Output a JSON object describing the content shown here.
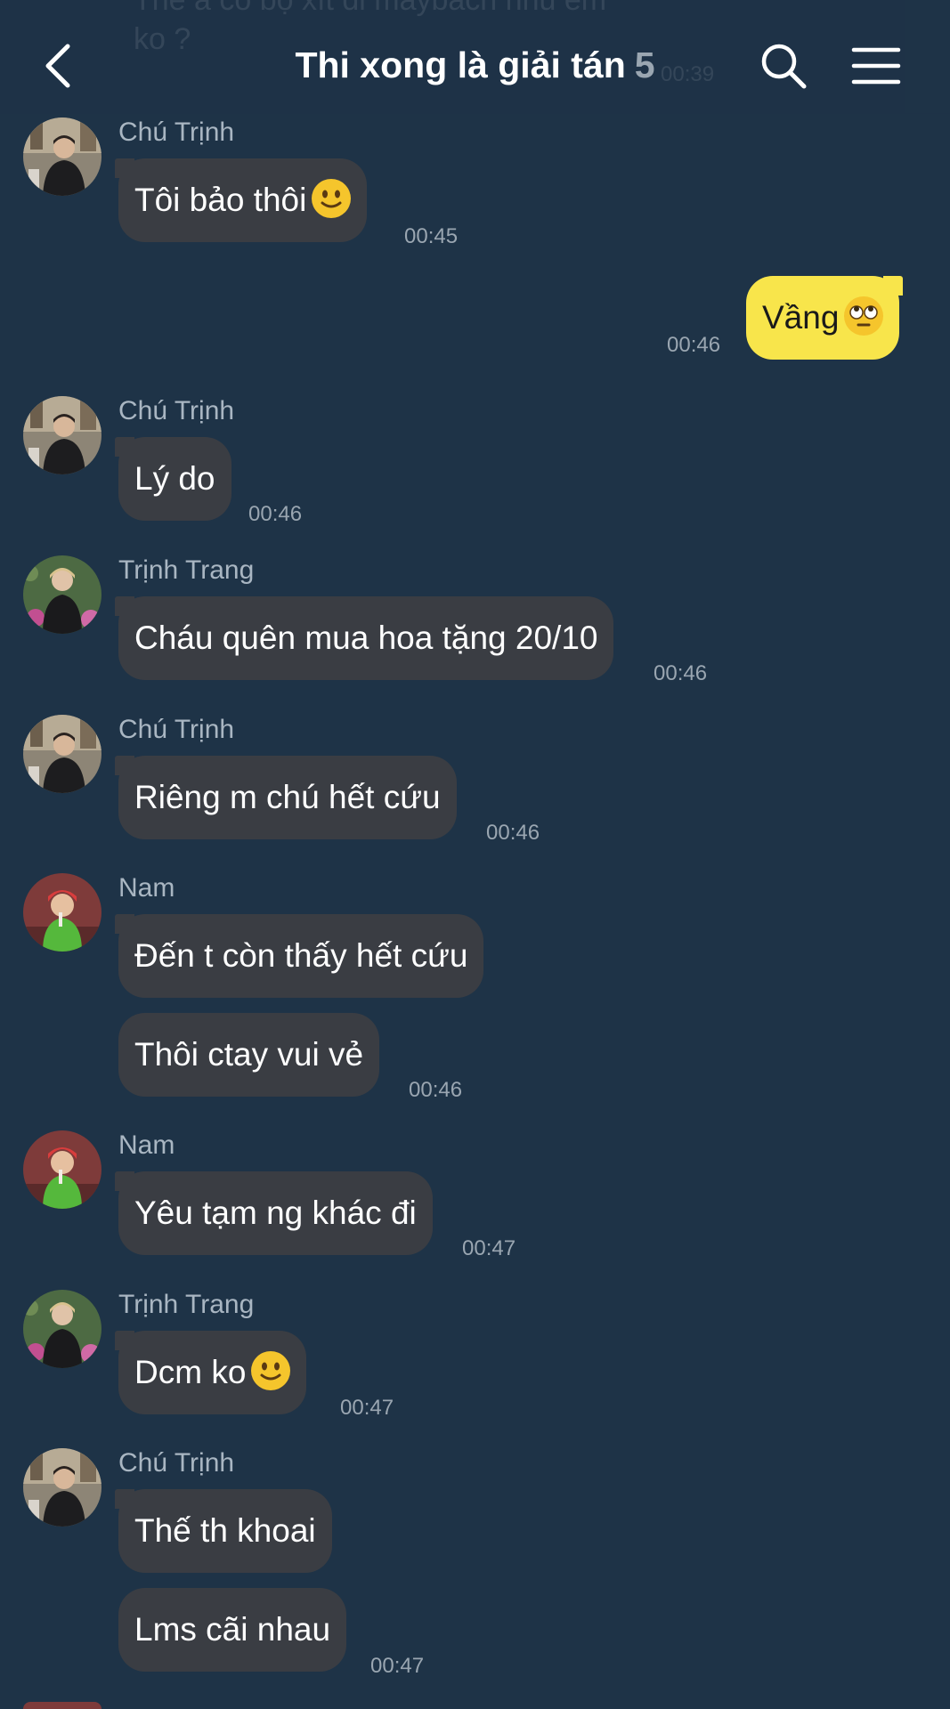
{
  "header": {
    "title": "Thi xong là giải tán",
    "member_count": "5",
    "prev_text": "Thế a có bộ xít đi maybach nhu em ko ?",
    "prev_time": "00:39"
  },
  "icons": {
    "back": "chevron-left-icon",
    "search": "search-icon",
    "menu": "hamburger-menu-icon",
    "slight_smile": "slightly-smiling-face-emoji",
    "eye_roll": "face-with-rolling-eyes-emoji"
  },
  "colors": {
    "background": "#1e3347",
    "bubble_other": "#3a3d43",
    "bubble_mine": "#f8e54b"
  },
  "messages": [
    {
      "sender": "Chú Trịnh",
      "text": "Tôi bảo thôi",
      "time": "00:45"
    },
    {
      "sender": "",
      "text": "Vầng",
      "time": "00:46",
      "mine": true
    },
    {
      "sender": "Chú Trịnh",
      "text": "Lý do",
      "time": "00:46"
    },
    {
      "sender": "Trịnh Trang",
      "text": "Cháu quên mua hoa tặng 20/10",
      "time": "00:46"
    },
    {
      "sender": "Chú Trịnh",
      "text": "Riêng m chú hết cứu",
      "time": "00:46"
    },
    {
      "sender": "Nam",
      "text": "Đến t còn thấy hết cứu",
      "time": ""
    },
    {
      "sender": "",
      "text": "Thôi ctay vui vẻ",
      "time": "00:46"
    },
    {
      "sender": "Nam",
      "text": "Yêu tạm ng khác đi",
      "time": "00:47"
    },
    {
      "sender": "Trịnh Trang",
      "text": "Dcm ko",
      "time": "00:47"
    },
    {
      "sender": "Chú Trịnh",
      "text": "Thế th khoai",
      "time": ""
    },
    {
      "sender": "",
      "text": "Lms cãi nhau",
      "time": "00:47"
    }
  ]
}
